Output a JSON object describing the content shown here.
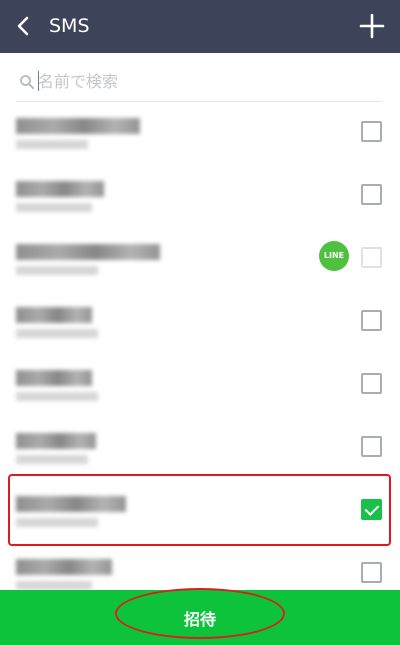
{
  "header": {
    "title": "SMS",
    "back_icon": "chevron-left-icon",
    "add_icon": "plus-icon",
    "background": "#3d4459"
  },
  "search": {
    "placeholder": "名前で検索",
    "value": "",
    "icon": "search-icon"
  },
  "contacts": [
    {
      "name": "",
      "detail": "",
      "checked": false,
      "disabled": false
    },
    {
      "name": "",
      "detail": "",
      "checked": false,
      "disabled": false
    },
    {
      "name": "",
      "detail": "",
      "checked": false,
      "disabled": true,
      "line_badge": "LINE"
    },
    {
      "name": "",
      "detail": "",
      "checked": false,
      "disabled": false
    },
    {
      "name": "",
      "detail": "",
      "checked": false,
      "disabled": false
    },
    {
      "name": "",
      "detail": "",
      "checked": false,
      "disabled": false
    },
    {
      "name": "",
      "detail": "",
      "checked": true,
      "disabled": false
    },
    {
      "name": "",
      "detail": "",
      "checked": false,
      "disabled": false
    }
  ],
  "invite_button": {
    "label": "招待",
    "color": "#0cc33b"
  },
  "annotation_color": "#e0191e"
}
